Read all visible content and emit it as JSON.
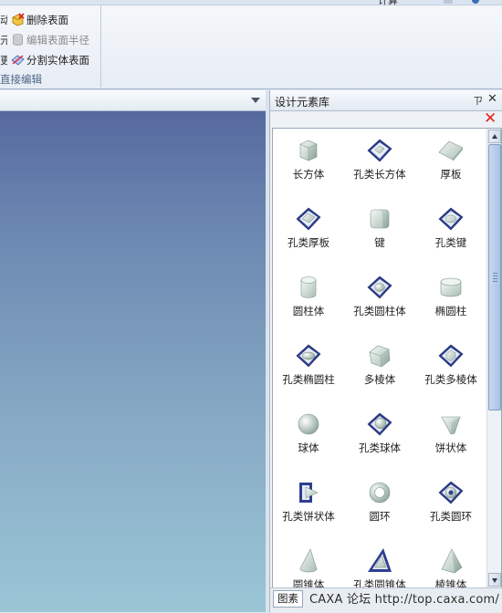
{
  "ribbon": {
    "tab_fragment": "计算",
    "items": [
      {
        "frag": "动",
        "label": "删除表面",
        "enabled": true,
        "icon": "delete-face-icon"
      },
      {
        "frag": "元",
        "label": "编辑表面半径",
        "enabled": false,
        "icon": "edit-face-radius-icon"
      },
      {
        "frag": "更",
        "label": "分割实体表面",
        "enabled": true,
        "icon": "split-solid-face-icon"
      }
    ],
    "group_label": "直接编辑"
  },
  "panel": {
    "title": "设计元素库",
    "pin_glyph": "ㄗ",
    "close_glyph": "✕",
    "delete_glyph": "✕",
    "elements": [
      {
        "label": "长方体",
        "icon": "cuboid-icon"
      },
      {
        "label": "孔类长方体",
        "icon": "hole-cuboid-icon"
      },
      {
        "label": "厚板",
        "icon": "slab-icon"
      },
      {
        "label": "孔类厚板",
        "icon": "hole-slab-icon"
      },
      {
        "label": "键",
        "icon": "key-icon"
      },
      {
        "label": "孔类键",
        "icon": "hole-key-icon"
      },
      {
        "label": "圆柱体",
        "icon": "cylinder-icon"
      },
      {
        "label": "孔类圆柱体",
        "icon": "hole-cylinder-icon"
      },
      {
        "label": "椭圆柱",
        "icon": "elliptic-cylinder-icon"
      },
      {
        "label": "孔类椭圆柱",
        "icon": "hole-elliptic-cylinder-icon"
      },
      {
        "label": "多棱体",
        "icon": "polyprism-icon"
      },
      {
        "label": "孔类多棱体",
        "icon": "hole-polyprism-icon"
      },
      {
        "label": "球体",
        "icon": "sphere-icon"
      },
      {
        "label": "孔类球体",
        "icon": "hole-sphere-icon"
      },
      {
        "label": "饼状体",
        "icon": "pie-solid-icon"
      },
      {
        "label": "孔类饼状体",
        "icon": "hole-pie-solid-icon"
      },
      {
        "label": "圆环",
        "icon": "torus-icon"
      },
      {
        "label": "孔类圆环",
        "icon": "hole-torus-icon"
      },
      {
        "label": "圆锥体",
        "icon": "cone-icon"
      },
      {
        "label": "孔类圆锥体",
        "icon": "hole-cone-icon"
      },
      {
        "label": "棱锥体",
        "icon": "pyramid-icon"
      }
    ],
    "bottom_tab": "图素",
    "watermark": "CAXA 论坛  http://top.caxa.com/"
  },
  "colors": {
    "viewport_top": "#56699f",
    "viewport_bottom": "#9ac6d6",
    "delete_red": "#e2231a",
    "hole_plate": "#2e3f8f"
  }
}
